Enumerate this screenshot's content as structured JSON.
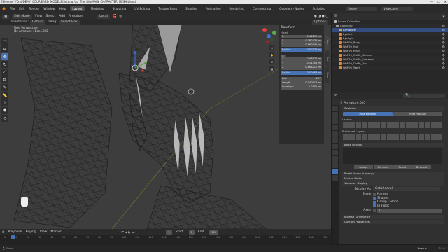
{
  "window": {
    "title": "[Blender* [D:\\UDEMY_COURSE\\3D_MODELS\\Setting_Up_The_Rig\\MAIN_CHARACTER_MESH.blend]"
  },
  "menubar": {
    "menus": [
      "File",
      "Edit",
      "Render",
      "Window",
      "Help"
    ],
    "workspaces": [
      "Layout",
      "Modeling",
      "Sculpting",
      "UV Editing",
      "Texture Paint",
      "Shading",
      "Animation",
      "Rendering",
      "Compositing",
      "Geometry Nodes",
      "Scripting"
    ],
    "active_workspace": "Layout",
    "scene": "Scene",
    "view_layer": "ViewLayer"
  },
  "viewport_header": {
    "mode": "Edit Mode",
    "menus": [
      "View",
      "Select",
      "Add",
      "Armature"
    ],
    "transform": "Local",
    "orientation_label": "Orientation:",
    "orientation_value": "Default",
    "drag_label": "Drag:",
    "drag_value": "Select Box",
    "options": "Options"
  },
  "viewport": {
    "info_line1": "User Perspective",
    "info_line2": "(1) Armature : Bone.222"
  },
  "transform_panel": {
    "title": "Transform",
    "head_label": "Head:",
    "head": [
      {
        "k": "X",
        "v": "0.44299 m"
      },
      {
        "k": "Y",
        "v": "-0.080736 m"
      },
      {
        "k": "Z",
        "v": "0.660145 m"
      }
    ],
    "head_radius": {
      "k": "Radius",
      "v": "0.00273 m"
    },
    "tail_label": "Tail:",
    "tail": [
      {
        "k": "X",
        "v": "0.43971 m"
      },
      {
        "k": "Y",
        "v": "-0.11306 m"
      },
      {
        "k": "Z",
        "v": "0.666217 m"
      }
    ],
    "tail_radius": {
      "k": "Radius",
      "v": "0.00488 m"
    },
    "roll": {
      "k": "Roll",
      "v": "-25°"
    },
    "length": {
      "k": "Length",
      "v": "0.040918 m"
    },
    "envelope": {
      "k": "Envelope",
      "v": "0.0101 m"
    },
    "tabs": [
      "Item",
      "Tool",
      "View"
    ]
  },
  "outliner": {
    "header": "Scene Collection",
    "rows": [
      {
        "name": "Collection",
        "color": "#9a9a9a"
      },
      {
        "name": "Armature",
        "color": "#d5a14a",
        "selected": true
      },
      {
        "name": "Eyelash",
        "color": "#e08a40"
      },
      {
        "name": "Eyelight",
        "color": "#e08a40"
      },
      {
        "name": "WoF00_Body",
        "color": "#e08a40"
      },
      {
        "name": "WoF00_Hair",
        "color": "#e08a40"
      },
      {
        "name": "WoF00_Head",
        "color": "#e08a40"
      },
      {
        "name": "WoF00_Outfit_Bottom",
        "color": "#e08a40"
      },
      {
        "name": "WoF00_Outfit_Footwear",
        "color": "#e08a40"
      },
      {
        "name": "WoF00_Outfit_Top",
        "color": "#e08a40"
      },
      {
        "name": "WoF00_Teeth",
        "color": "#e08a40"
      }
    ]
  },
  "properties": {
    "object_name": "Armature.005",
    "skeleton_panel": "Skeleton",
    "pose_position": "Pose Position",
    "rest_position": "Rest Position",
    "layers_label": "Layers:",
    "protected_label": "Protected Layers:",
    "bone_groups": "Bone Groups",
    "assign": "Assign",
    "remove": "Remove",
    "select": "Select",
    "deselect": "Deselect",
    "pose_library": "Pose Library (Legacy)",
    "motion_paths": "Motion Paths",
    "viewport_display": "Viewport Display",
    "display_as_label": "Display As",
    "display_as_value": "Octahedral",
    "show_label": "Show",
    "show_options": [
      {
        "label": "Names",
        "checked": false
      },
      {
        "label": "Shapes",
        "checked": true
      },
      {
        "label": "Group Colors",
        "checked": true
      },
      {
        "label": "In Front",
        "checked": true
      }
    ],
    "axes_label": "Axes",
    "axes_value": "0",
    "inverse_kinematics": "Inverse Kinematics",
    "custom_props": "Custom Properties"
  },
  "timeline": {
    "playback": "Playback",
    "keying": "Keying",
    "view": "View",
    "marker": "Marker",
    "current": "1",
    "start_label": "Start",
    "start": "1",
    "end_label": "End",
    "end": "250",
    "ticks": [
      "0",
      "10",
      "20",
      "30",
      "40",
      "50",
      "60",
      "70",
      "80",
      "90",
      "100",
      "110",
      "120",
      "130",
      "140",
      "150",
      "160",
      "170",
      "180",
      "190",
      "200",
      "210",
      "220",
      "230",
      "240",
      "250"
    ]
  },
  "status": {
    "left": "Move",
    "right": "3.1.0",
    "udemy": "Udemy"
  }
}
